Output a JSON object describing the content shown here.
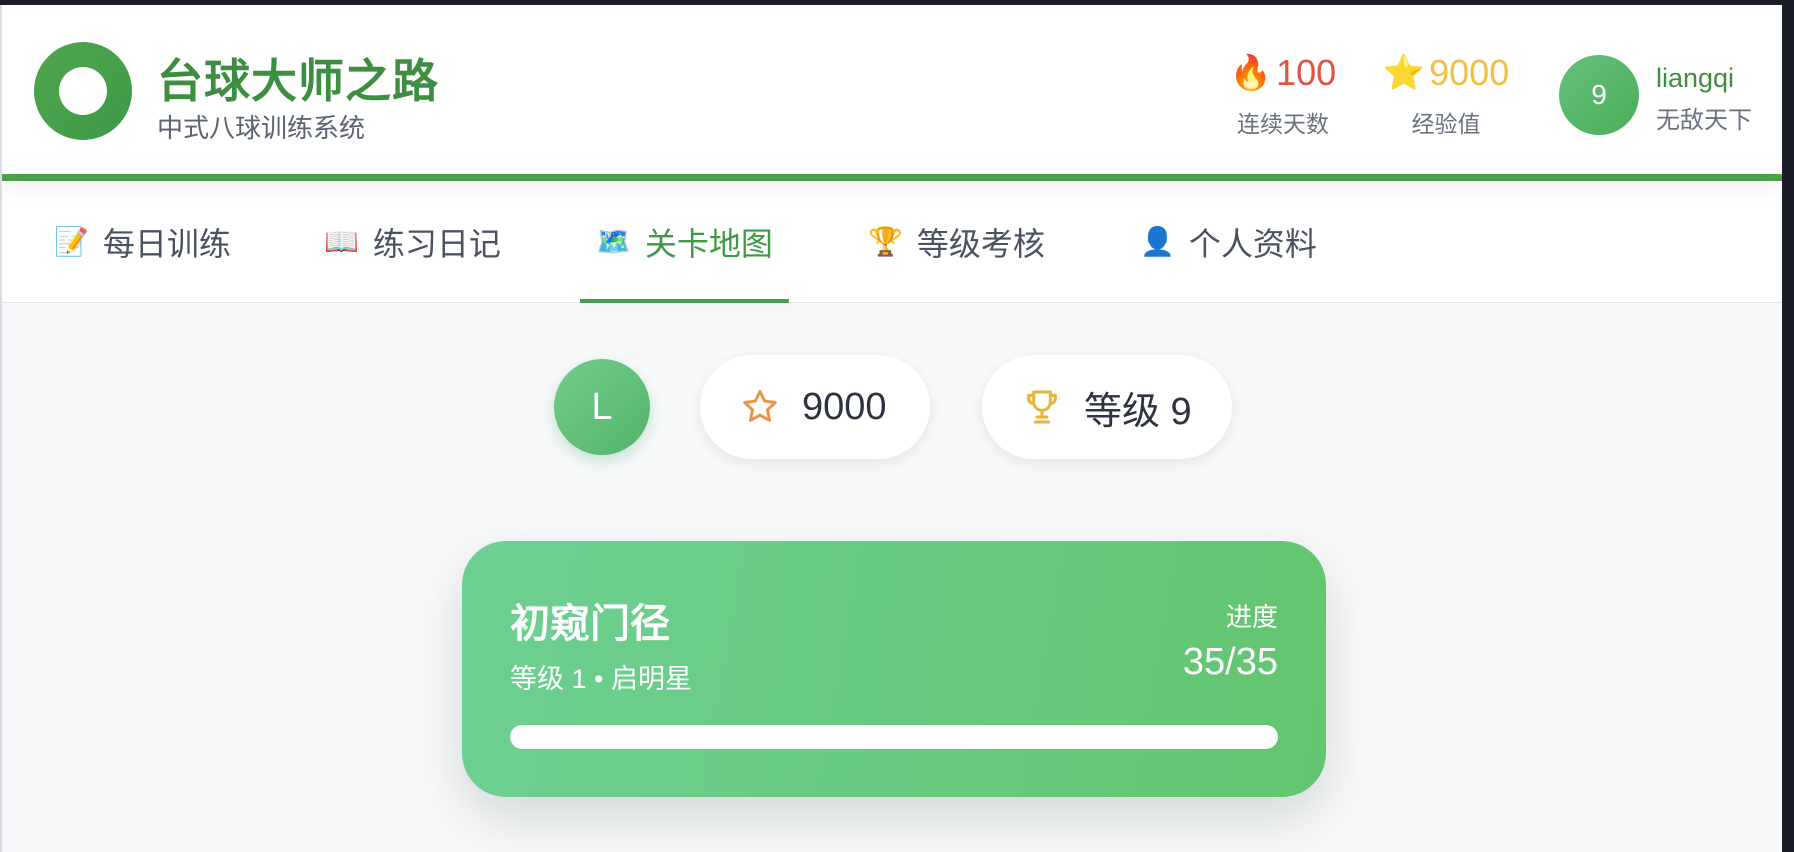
{
  "header": {
    "title": "台球大师之路",
    "subtitle": "中式八球训练系统",
    "streak": {
      "icon": "🔥",
      "value": "100",
      "label": "连续天数"
    },
    "experience": {
      "icon": "⭐",
      "value": "9000",
      "label": "经验值"
    },
    "user": {
      "avatar_text": "9",
      "name": "liangqi",
      "title": "无敌天下"
    }
  },
  "nav": {
    "tabs": [
      {
        "icon": "📝",
        "label": "每日训练"
      },
      {
        "icon": "📖",
        "label": "练习日记"
      },
      {
        "icon": "🗺️",
        "label": "关卡地图",
        "active": true
      },
      {
        "icon": "🏆",
        "label": "等级考核"
      },
      {
        "icon": "👤",
        "label": "个人资料"
      }
    ]
  },
  "summary": {
    "avatar_letter": "L",
    "xp_value": "9000",
    "level_text": "等级 9",
    "colors": {
      "star": "#e8944a",
      "trophy": "#e6b53a"
    }
  },
  "level_card": {
    "title": "初窥门径",
    "subtitle": "等级 1 • 启明星",
    "progress_label": "进度",
    "progress_text": "35/35",
    "progress_fraction": 1.0
  },
  "colors": {
    "brand": "#3e8e41",
    "accent": "#4a9f4e"
  }
}
